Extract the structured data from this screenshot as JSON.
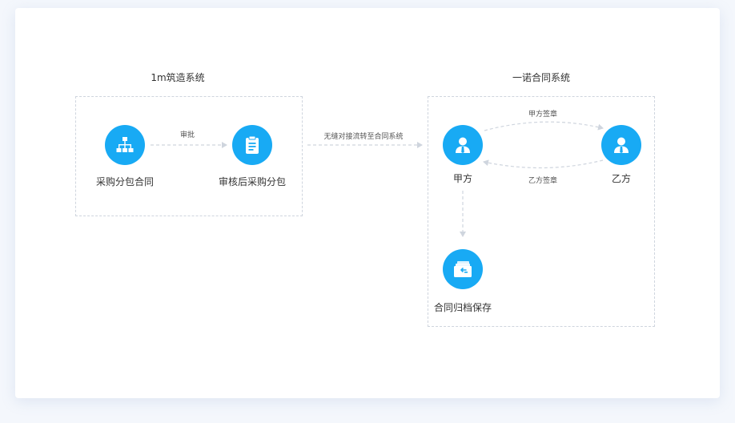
{
  "systems": {
    "left_title": "1m筑造系统",
    "right_title": "一诺合同系统"
  },
  "nodes": {
    "purchase_package": "采购分包合同",
    "approved_package": "审核后采购分包",
    "party_a": "甲方",
    "party_b": "乙方",
    "archive": "合同归档保存"
  },
  "edges": {
    "approve": "审批",
    "transfer": "无缝对接流转至合同系统",
    "a_sign": "甲方签章",
    "b_sign": "乙方签章"
  },
  "colors": {
    "node": "#18aaf4",
    "arrow": "#cfd5de",
    "border": "#cfd5de"
  },
  "icons": {
    "purchase_package": "org-chart-icon",
    "approved_package": "clipboard-icon",
    "party_a": "user-icon",
    "party_b": "user-icon",
    "archive": "folder-archive-icon"
  }
}
